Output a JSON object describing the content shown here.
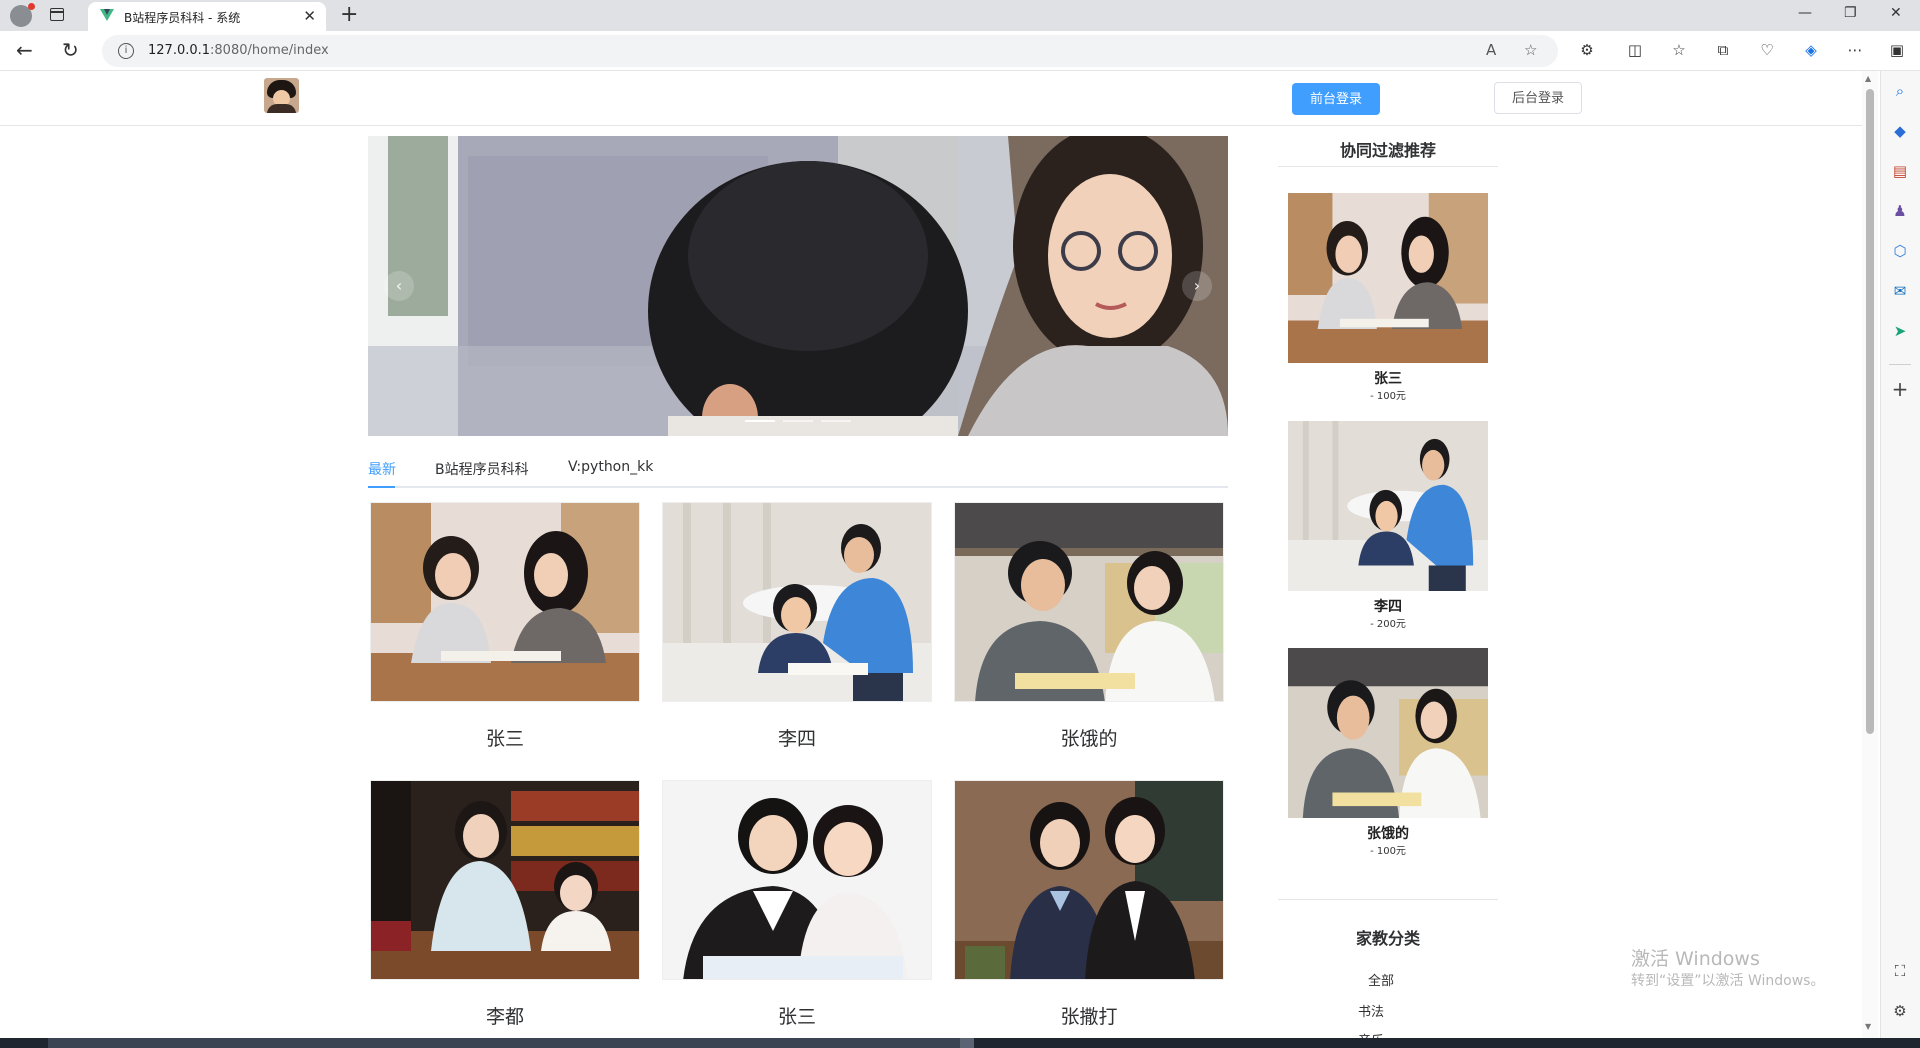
{
  "browser": {
    "tab_title": "B站程序员科科 - 系统",
    "url_host": "127.0.0.1",
    "url_path": ":8080/home/index"
  },
  "header": {
    "front_login": "前台登录",
    "back_login": "后台登录"
  },
  "tabs": [
    {
      "label": "最新"
    },
    {
      "label": "B站程序员科科"
    },
    {
      "label": "V:python_kk"
    }
  ],
  "products": [
    {
      "name": "张三"
    },
    {
      "name": "李四"
    },
    {
      "name": "张饿的"
    },
    {
      "name": "李都"
    },
    {
      "name": "张三"
    },
    {
      "name": "张撒打"
    }
  ],
  "recommend": {
    "title": "协同过滤推荐",
    "items": [
      {
        "name": "张三",
        "price": "- 100元"
      },
      {
        "name": "李四",
        "price": "- 200元"
      },
      {
        "name": "张饿的",
        "price": "- 100元"
      }
    ]
  },
  "categories": {
    "title": "家教分类",
    "items": [
      "全部",
      "书法",
      "音乐"
    ]
  },
  "watermark": {
    "line1": "激活 Windows",
    "line2": "转到“设置”以激活 Windows。"
  },
  "colors": {
    "accent": "#409eff",
    "sidebar_bg": "#f7f7f7"
  }
}
